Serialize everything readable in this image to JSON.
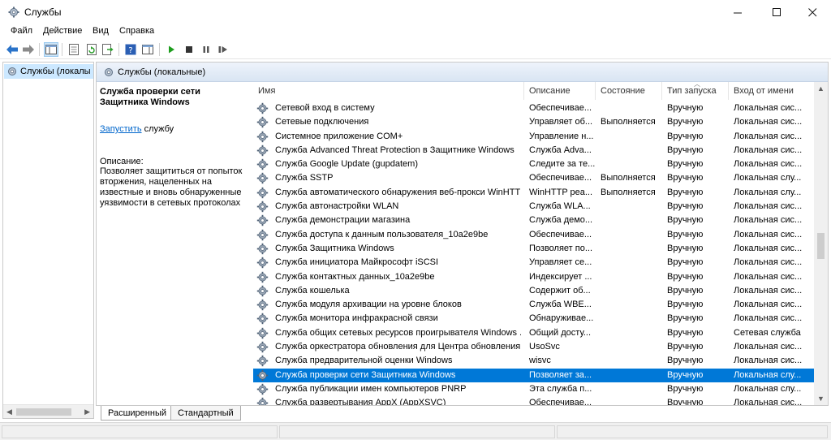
{
  "window": {
    "title": "Службы"
  },
  "menu": [
    "Файл",
    "Действие",
    "Вид",
    "Справка"
  ],
  "tree": {
    "item": "Службы (локалы"
  },
  "main": {
    "header": "Службы (локальные)",
    "detail": {
      "title": "Служба проверки сети Защитника Windows",
      "start_link": "Запустить",
      "start_suffix": " службу",
      "desc_label": "Описание:",
      "desc_text": "Позволяет защититься от попыток вторжения, нацеленных на известные и вновь обнаруженные уязвимости в сетевых протоколах"
    },
    "columns": [
      "Имя",
      "Описание",
      "Состояние",
      "Тип запуска",
      "Вход от имени"
    ],
    "rows": [
      [
        "Сетевой вход в систему",
        "Обеспечивае...",
        "",
        "Вручную",
        "Локальная сис..."
      ],
      [
        "Сетевые подключения",
        "Управляет об...",
        "Выполняется",
        "Вручную",
        "Локальная сис..."
      ],
      [
        "Системное приложение COM+",
        "Управление н...",
        "",
        "Вручную",
        "Локальная сис..."
      ],
      [
        "Служба Advanced Threat Protection в Защитнике Windows",
        "Служба Adva...",
        "",
        "Вручную",
        "Локальная сис..."
      ],
      [
        "Служба Google Update (gupdatem)",
        "Следите за те...",
        "",
        "Вручную",
        "Локальная сис..."
      ],
      [
        "Служба SSTP",
        "Обеспечивае...",
        "Выполняется",
        "Вручную",
        "Локальная слу..."
      ],
      [
        "Служба автоматического обнаружения веб-прокси WinHTTP",
        "WinHTTP реа...",
        "Выполняется",
        "Вручную",
        "Локальная слу..."
      ],
      [
        "Служба автонастройки WLAN",
        "Служба WLA...",
        "",
        "Вручную",
        "Локальная сис..."
      ],
      [
        "Служба демонстрации магазина",
        "Служба демо...",
        "",
        "Вручную",
        "Локальная сис..."
      ],
      [
        "Служба доступа к данным пользователя_10a2e9be",
        "Обеспечивае...",
        "",
        "Вручную",
        "Локальная сис..."
      ],
      [
        "Служба Защитника Windows",
        "Позволяет по...",
        "",
        "Вручную",
        "Локальная сис..."
      ],
      [
        "Служба инициатора Майкрософт iSCSI",
        "Управляет се...",
        "",
        "Вручную",
        "Локальная сис..."
      ],
      [
        "Служба контактных данных_10a2e9be",
        "Индексирует ...",
        "",
        "Вручную",
        "Локальная сис..."
      ],
      [
        "Служба кошелька",
        "Содержит об...",
        "",
        "Вручную",
        "Локальная сис..."
      ],
      [
        "Служба модуля архивации на уровне блоков",
        "Служба WBE...",
        "",
        "Вручную",
        "Локальная сис..."
      ],
      [
        "Служба монитора инфракрасной связи",
        "Обнаруживае...",
        "",
        "Вручную",
        "Локальная сис..."
      ],
      [
        "Служба общих сетевых ресурсов проигрывателя Windows ...",
        "Общий досту...",
        "",
        "Вручную",
        "Сетевая служба"
      ],
      [
        "Служба оркестратора обновления для Центра обновления ...",
        "UsoSvc",
        "",
        "Вручную",
        "Локальная сис..."
      ],
      [
        "Служба предварительной оценки Windows",
        "wisvc",
        "",
        "Вручную",
        "Локальная сис..."
      ],
      [
        "Служба проверки сети Защитника Windows",
        "Позволяет за...",
        "",
        "Вручную",
        "Локальная слу..."
      ],
      [
        "Служба публикации имен компьютеров PNRP",
        "Эта служба п...",
        "",
        "Вручную",
        "Локальная слу..."
      ],
      [
        "Служба развертывания AppX (AppXSVC)",
        "Обеспечивае...",
        "",
        "Вручную",
        "Локальная сис..."
      ]
    ],
    "selected_row": 19
  },
  "tabs": [
    "Расширенный",
    "Стандартный"
  ],
  "colors": {
    "selection": "#0078d7",
    "tree_selection": "#cce8ff",
    "link": "#0066cc",
    "play": "#1e9e1e"
  }
}
